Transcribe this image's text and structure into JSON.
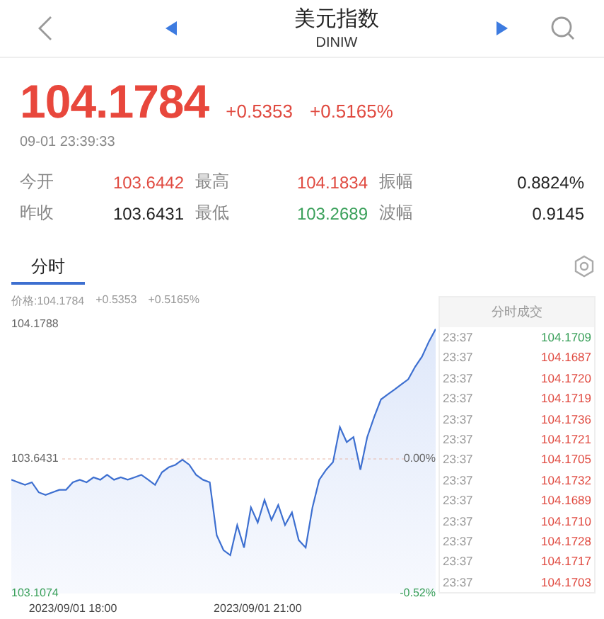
{
  "header": {
    "title": "美元指数",
    "code": "DINIW"
  },
  "quote": {
    "price": "104.1784",
    "change": "+0.5353",
    "change_pct": "+0.5165%",
    "time": "09-01 23:39:33"
  },
  "stats": [
    {
      "label": "今开",
      "value": "103.6442",
      "color": "#e04a40"
    },
    {
      "label": "最高",
      "value": "104.1834",
      "color": "#e04a40"
    },
    {
      "label": "振幅",
      "value": "0.8824%",
      "color": "#222222"
    },
    {
      "label": "昨收",
      "value": "103.6431",
      "color": "#222222"
    },
    {
      "label": "最低",
      "value": "103.2689",
      "color": "#3aa05a"
    },
    {
      "label": "波幅",
      "value": "0.9145",
      "color": "#222222"
    }
  ],
  "tabs": [
    {
      "label": "分时",
      "selected": true
    }
  ],
  "chart": {
    "info": [
      "价格:104.1784",
      "+0.5353",
      "+0.5165%"
    ],
    "zero_pct": "0.00%",
    "low_pct": "-0.52%",
    "chart_data": {
      "type": "area",
      "ylim": [
        103.1074,
        104.1788
      ],
      "categories": [
        null,
        null,
        null,
        null,
        null,
        null,
        null,
        null,
        null,
        "2023/09/01 18:00",
        null,
        null,
        null,
        null,
        null,
        null,
        null,
        null,
        null,
        null,
        null,
        null,
        null,
        null,
        null,
        null,
        null,
        null,
        null,
        null,
        null,
        null,
        null,
        null,
        null,
        null,
        "2023/09/01 21:00",
        null,
        null,
        null,
        null,
        null,
        null,
        null,
        null,
        null,
        null,
        null,
        null,
        null,
        null,
        null,
        null,
        null,
        null,
        null,
        null,
        null,
        null,
        null,
        null,
        null,
        null
      ],
      "yticks": [
        {
          "value": 104.1788,
          "label": "104.1788"
        },
        {
          "value": 103.6431,
          "label": "103.6431"
        },
        {
          "value": 103.1074,
          "label": "103.1074"
        }
      ],
      "series": [
        {
          "color": "#3d6fd0",
          "values": [
            103.56,
            103.55,
            103.54,
            103.55,
            103.51,
            103.5,
            103.51,
            103.52,
            103.52,
            103.55,
            103.56,
            103.55,
            103.57,
            103.56,
            103.58,
            103.56,
            103.57,
            103.56,
            103.57,
            103.58,
            103.56,
            103.54,
            103.59,
            103.61,
            103.62,
            103.64,
            103.62,
            103.58,
            103.56,
            103.55,
            103.34,
            103.28,
            103.26,
            103.38,
            103.29,
            103.45,
            103.39,
            103.48,
            103.4,
            103.46,
            103.38,
            103.43,
            103.32,
            103.29,
            103.45,
            103.56,
            103.6,
            103.63,
            103.77,
            103.71,
            103.73,
            103.6,
            103.73,
            103.81,
            103.88,
            103.9,
            103.92,
            103.94,
            103.96,
            104.01,
            104.05,
            104.11,
            104.16
          ]
        }
      ]
    }
  },
  "trades": {
    "title": "分时成交",
    "rows": [
      {
        "time": "23:37",
        "price": "104.1709",
        "color": "#3aa05a"
      },
      {
        "time": "23:37",
        "price": "104.1687",
        "color": "#e04a40"
      },
      {
        "time": "23:37",
        "price": "104.1720",
        "color": "#e04a40"
      },
      {
        "time": "23:37",
        "price": "104.1719",
        "color": "#e04a40"
      },
      {
        "time": "23:37",
        "price": "104.1736",
        "color": "#e04a40"
      },
      {
        "time": "23:37",
        "price": "104.1721",
        "color": "#e04a40"
      },
      {
        "time": "23:37",
        "price": "104.1705",
        "color": "#e04a40"
      },
      {
        "time": "23:37",
        "price": "104.1732",
        "color": "#e04a40"
      },
      {
        "time": "23:37",
        "price": "104.1689",
        "color": "#e04a40"
      },
      {
        "time": "23:37",
        "price": "104.1710",
        "color": "#e04a40"
      },
      {
        "time": "23:37",
        "price": "104.1728",
        "color": "#e04a40"
      },
      {
        "time": "23:37",
        "price": "104.1717",
        "color": "#e04a40"
      },
      {
        "time": "23:37",
        "price": "104.1703",
        "color": "#e04a40"
      }
    ]
  }
}
